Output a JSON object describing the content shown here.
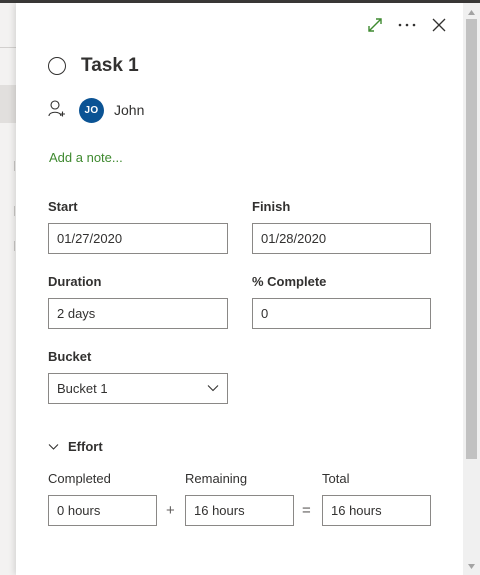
{
  "task": {
    "title": "Task 1"
  },
  "assignee": {
    "initials": "JO",
    "name": "John",
    "avatar_color": "#0b5394"
  },
  "notes": {
    "add_note_label": "Add a note..."
  },
  "dates": {
    "start_label": "Start",
    "start_value": "01/27/2020",
    "finish_label": "Finish",
    "finish_value": "01/28/2020"
  },
  "progress": {
    "duration_label": "Duration",
    "duration_value": "2 days",
    "percent_label": "% Complete",
    "percent_value": "0"
  },
  "bucket": {
    "label": "Bucket",
    "selected": "Bucket 1"
  },
  "effort": {
    "title": "Effort",
    "completed_label": "Completed",
    "completed_value": "0 hours",
    "remaining_label": "Remaining",
    "remaining_value": "16 hours",
    "total_label": "Total",
    "total_value": "16 hours",
    "plus_sign": "+",
    "equals_sign": "="
  },
  "header_icons": {
    "expand": "expand-icon",
    "more": "more-options-icon",
    "close": "close-icon"
  },
  "colors": {
    "accent_green": "#3f8a30",
    "text": "#323130",
    "border": "#8a8886"
  }
}
